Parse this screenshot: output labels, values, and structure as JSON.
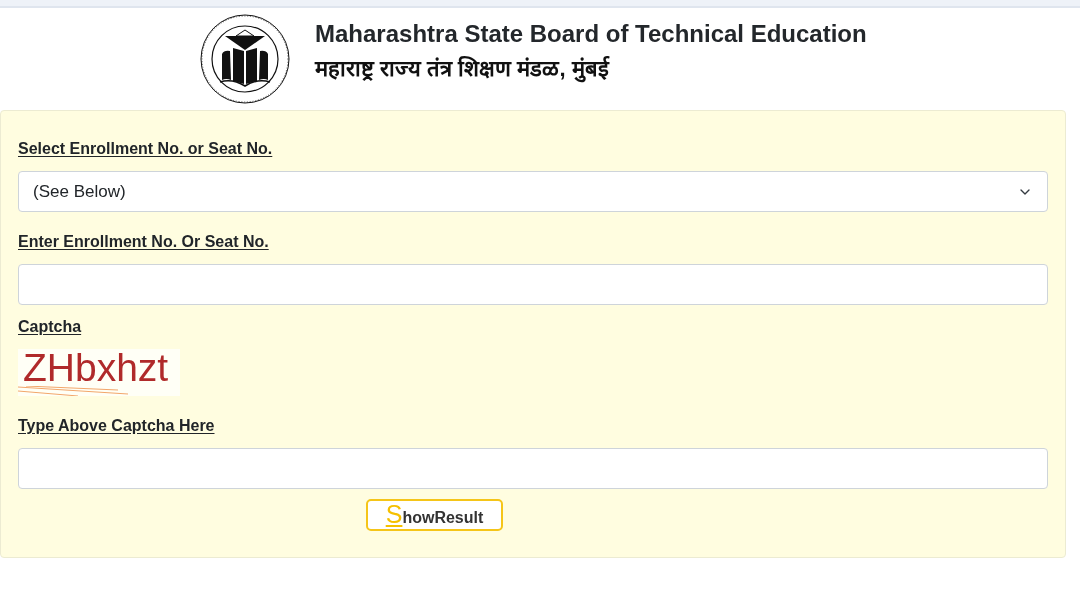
{
  "header": {
    "title": "Maharashtra State Board of Technical Education",
    "subtitle": "महाराष्ट्र राज्य तंत्र शिक्षण मंडळ, मुंबई"
  },
  "form": {
    "fields": [
      {
        "kind": "select",
        "label": "Select Enrollment No. or Seat No.",
        "value": "(See Below)"
      },
      {
        "kind": "input",
        "label": "Enter Enrollment No. Or Seat No."
      },
      {
        "kind": "captcha",
        "label": "Captcha",
        "text": "ZHbxhzt"
      },
      {
        "kind": "input",
        "label": "Type Above Captcha Here"
      }
    ],
    "submit_button": {
      "label": "ShowResult"
    }
  }
}
